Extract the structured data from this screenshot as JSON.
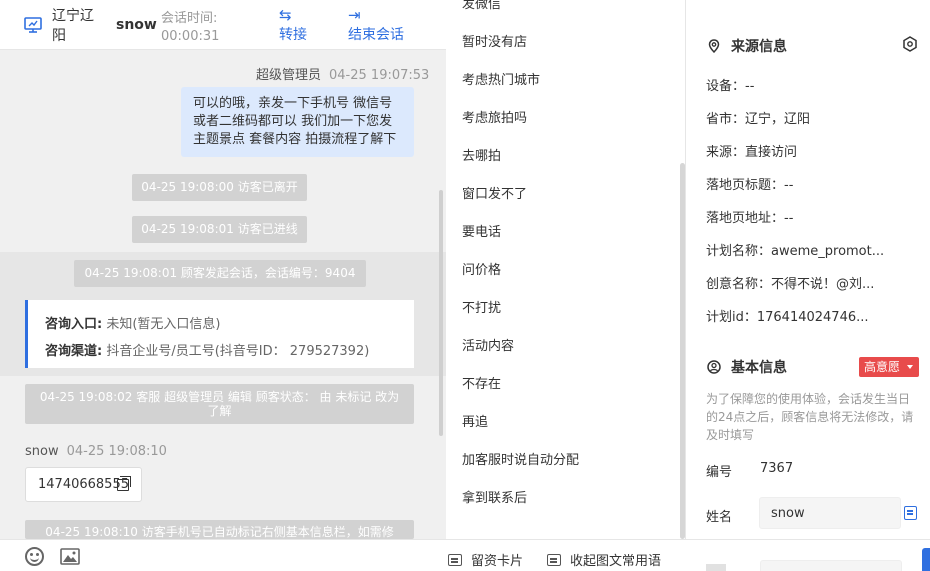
{
  "header": {
    "location": "辽宁辽阳",
    "visitor": "snow",
    "session_time_label": "会话时间:",
    "session_time": "00:00:31",
    "transfer_label": "转接",
    "end_label": "结束会话"
  },
  "chat": {
    "agent_name": "超级管理员",
    "agent_time": "04-25 19:07:53",
    "agent_message": "可以的哦，亲发一下手机号 微信号或者二维码都可以 我们加一下您发主题景点 套餐内容 拍摄流程了解下",
    "sys_left": "04-25 19:08:00 访客已离开",
    "sys_enter": "04-25 19:08:01 访客已进线",
    "sys_session": "04-25 19:08:01 顾客发起会话，会话编号：9404",
    "entry_label": "咨询入口:",
    "entry_value": "未知(暂无入口信息)",
    "channel_label": "咨询渠道:",
    "channel_value": "抖音企业号/员工号(抖音号ID： 279527392)",
    "sys_status": "04-25 19:08:02 客服 超级管理员 编辑 顾客状态： 由 未标记 改为 了解",
    "visitor_name": "snow",
    "visitor_time": "04-25 19:08:10",
    "visitor_message": "14740668555",
    "sys_auto": "04-25 19:08:10 访客手机号已自动标记右侧基本信息栏，如需修"
  },
  "footer": {
    "card_label": "留资卡片",
    "collapse_label": "收起图文常用语"
  },
  "quick_replies": {
    "partial_top": "发微信",
    "items": [
      "暂时没有店",
      "考虑热门城市",
      "考虑旅拍吗",
      "去哪拍",
      "窗口发不了",
      "要电话",
      "问价格",
      "不打扰",
      "活动内容",
      "不存在",
      "再追",
      "加客服时说自动分配",
      "拿到联系后"
    ]
  },
  "source": {
    "title": "来源信息",
    "device": "设备：--",
    "province": "省市：辽宁，辽阳",
    "origin": "来源：直接访问",
    "landing_title": "落地页标题：--",
    "landing_url": "落地页地址：--",
    "plan_name": "计划名称：aweme_promot...",
    "creative_name": "创意名称：不得不说！@刘...",
    "plan_id": "计划id：176414024746..."
  },
  "basic": {
    "title": "基本信息",
    "intent_badge": "高意愿",
    "notice": "为了保障您的使用体验，会话发生当日的24点之后，顾客信息将无法修改，请及时填写",
    "id_label": "编号",
    "id_value": "7367",
    "name_label": "姓名",
    "name_value": "snow"
  },
  "colors": {
    "accent": "#2f6fe0",
    "bubble": "#dce9fd",
    "badge": "#e84b4b"
  }
}
